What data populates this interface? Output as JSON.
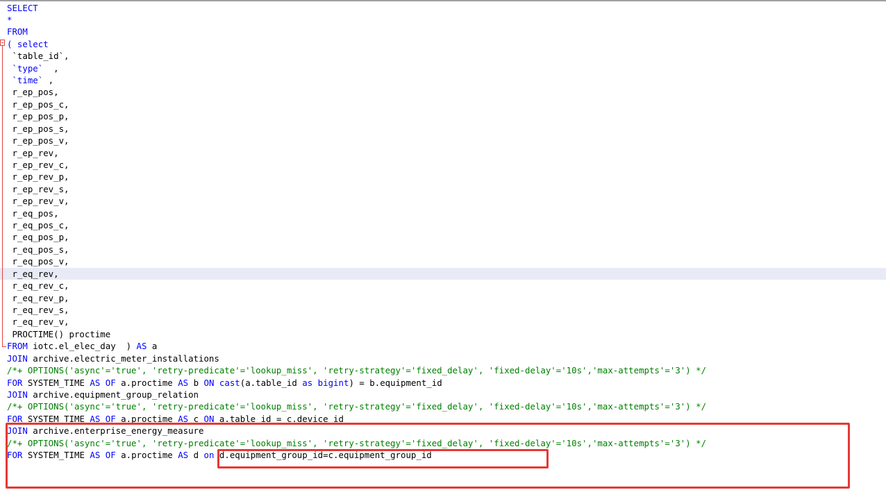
{
  "editor": {
    "current_line_index": 22,
    "lines": [
      [
        {
          "t": "SELECT",
          "c": "kw"
        }
      ],
      [
        {
          "t": "*",
          "c": "kw"
        }
      ],
      [
        {
          "t": "FROM",
          "c": "kw"
        }
      ],
      [
        {
          "t": "( select",
          "c": "kw"
        }
      ],
      [
        {
          "t": " `table_id`,",
          "c": ""
        }
      ],
      [
        {
          "t": " `type`",
          "c": "kw"
        },
        {
          "t": "  ,",
          "c": ""
        }
      ],
      [
        {
          "t": " `time`",
          "c": "kw"
        },
        {
          "t": " ,",
          "c": ""
        }
      ],
      [
        {
          "t": " r_ep_pos,",
          "c": ""
        }
      ],
      [
        {
          "t": " r_ep_pos_c,",
          "c": ""
        }
      ],
      [
        {
          "t": " r_ep_pos_p,",
          "c": ""
        }
      ],
      [
        {
          "t": " r_ep_pos_s,",
          "c": ""
        }
      ],
      [
        {
          "t": " r_ep_pos_v,",
          "c": ""
        }
      ],
      [
        {
          "t": " r_ep_rev,",
          "c": ""
        }
      ],
      [
        {
          "t": " r_ep_rev_c,",
          "c": ""
        }
      ],
      [
        {
          "t": " r_ep_rev_p,",
          "c": ""
        }
      ],
      [
        {
          "t": " r_ep_rev_s,",
          "c": ""
        }
      ],
      [
        {
          "t": " r_ep_rev_v,",
          "c": ""
        }
      ],
      [
        {
          "t": " r_eq_pos,",
          "c": ""
        }
      ],
      [
        {
          "t": " r_eq_pos_c,",
          "c": ""
        }
      ],
      [
        {
          "t": " r_eq_pos_p,",
          "c": ""
        }
      ],
      [
        {
          "t": " r_eq_pos_s,",
          "c": ""
        }
      ],
      [
        {
          "t": " r_eq_pos_v,",
          "c": ""
        }
      ],
      [
        {
          "t": " r_eq_rev,",
          "c": ""
        }
      ],
      [
        {
          "t": " r_eq_rev_c,",
          "c": ""
        }
      ],
      [
        {
          "t": " r_eq_rev_p,",
          "c": ""
        }
      ],
      [
        {
          "t": " r_eq_rev_s,",
          "c": ""
        }
      ],
      [
        {
          "t": " r_eq_rev_v,",
          "c": ""
        }
      ],
      [
        {
          "t": " PROCTIME() proctime",
          "c": ""
        }
      ],
      [
        {
          "t": "FROM",
          "c": "kw"
        },
        {
          "t": " iotc.el_elec_day  ) ",
          "c": ""
        },
        {
          "t": "AS",
          "c": "kw"
        },
        {
          "t": " a",
          "c": ""
        }
      ],
      [
        {
          "t": "JOIN",
          "c": "kw"
        },
        {
          "t": " archive.electric_meter_installations",
          "c": ""
        }
      ],
      [
        {
          "t": "/*+ OPTIONS('async'='true', 'retry-predicate'='lookup_miss', 'retry-strategy'='fixed_delay', 'fixed-delay'='10s','max-attempts'='3') */",
          "c": "cm"
        }
      ],
      [
        {
          "t": "FOR",
          "c": "kw"
        },
        {
          "t": " SYSTEM_TIME ",
          "c": ""
        },
        {
          "t": "AS OF",
          "c": "kw"
        },
        {
          "t": " a.proctime ",
          "c": ""
        },
        {
          "t": "AS",
          "c": "kw"
        },
        {
          "t": " b ",
          "c": ""
        },
        {
          "t": "ON",
          "c": "kw"
        },
        {
          "t": " ",
          "c": ""
        },
        {
          "t": "cast",
          "c": "kw"
        },
        {
          "t": "(a.table_id ",
          "c": ""
        },
        {
          "t": "as bigint",
          "c": "kw"
        },
        {
          "t": ") = b.equipment_id",
          "c": ""
        }
      ],
      [
        {
          "t": "JOIN",
          "c": "kw"
        },
        {
          "t": " archive.equipment_group_relation",
          "c": ""
        }
      ],
      [
        {
          "t": "/*+ OPTIONS('async'='true', 'retry-predicate'='lookup_miss', 'retry-strategy'='fixed_delay', 'fixed-delay'='10s','max-attempts'='3') */",
          "c": "cm"
        }
      ],
      [
        {
          "t": "FOR",
          "c": "kw"
        },
        {
          "t": " SYSTEM_TIME ",
          "c": ""
        },
        {
          "t": "AS OF",
          "c": "kw"
        },
        {
          "t": " a.proctime ",
          "c": ""
        },
        {
          "t": "AS",
          "c": "kw"
        },
        {
          "t": " c ",
          "c": ""
        },
        {
          "t": "ON",
          "c": "kw"
        },
        {
          "t": " a.table_id = c.device_id",
          "c": ""
        }
      ],
      [
        {
          "t": "JOIN",
          "c": "kw"
        },
        {
          "t": " archive.enterprise_energy_measure",
          "c": ""
        }
      ],
      [
        {
          "t": "/*+ OPTIONS('async'='true', 'retry-predicate'='lookup_miss', 'retry-strategy'='fixed_delay', 'fixed-delay'='10s','max-attempts'='3') */",
          "c": "cm"
        }
      ],
      [
        {
          "t": "FOR",
          "c": "kw"
        },
        {
          "t": " SYSTEM_TIME ",
          "c": ""
        },
        {
          "t": "AS OF",
          "c": "kw"
        },
        {
          "t": " a.proctime ",
          "c": ""
        },
        {
          "t": "AS",
          "c": "kw"
        },
        {
          "t": " d ",
          "c": ""
        },
        {
          "t": "on",
          "c": "kw"
        },
        {
          "t": " d.equipment_group_id=c.equipment_group_id",
          "c": ""
        }
      ]
    ]
  },
  "colors": {
    "keyword": "#0000ff",
    "comment": "#008000",
    "text": "#000000",
    "highlight_box": "#e53935",
    "current_line": "#e8eaf6"
  }
}
